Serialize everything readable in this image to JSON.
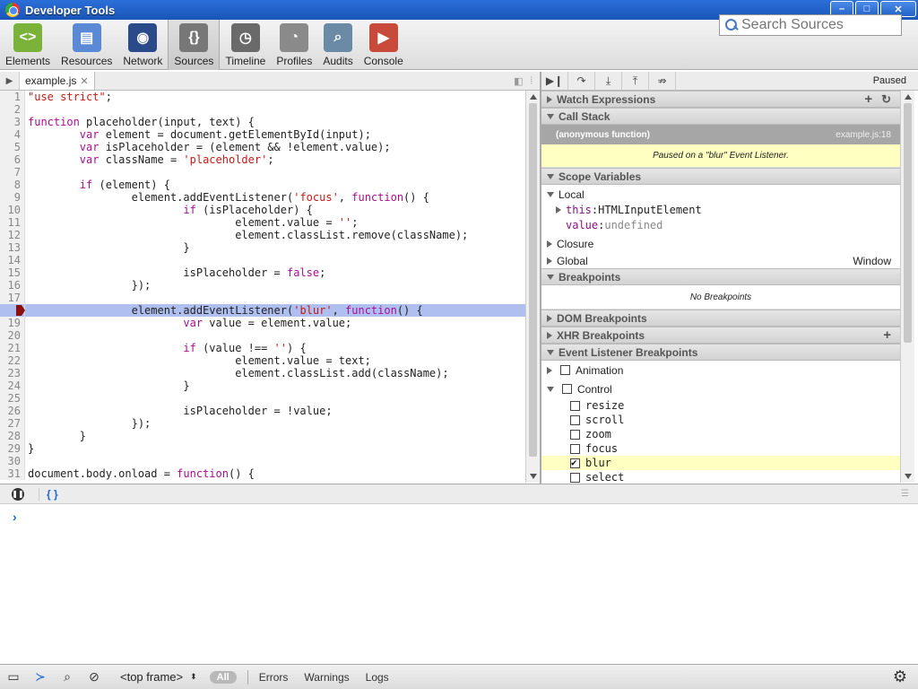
{
  "window": {
    "title": "Developer Tools",
    "controls": [
      "–",
      "□",
      "✕"
    ]
  },
  "toolbar": {
    "tools": [
      {
        "label": "Elements",
        "icon": "elements-icon",
        "color": "#7bb33a",
        "glyph": "<>"
      },
      {
        "label": "Resources",
        "icon": "resources-icon",
        "color": "#5a8ad6",
        "glyph": "▤"
      },
      {
        "label": "Network",
        "icon": "network-icon",
        "color": "#2a4a8a",
        "glyph": "◉"
      },
      {
        "label": "Sources",
        "icon": "sources-icon",
        "color": "#777777",
        "glyph": "{}"
      },
      {
        "label": "Timeline",
        "icon": "timeline-icon",
        "color": "#6a6a6a",
        "glyph": "◷"
      },
      {
        "label": "Profiles",
        "icon": "profiles-icon",
        "color": "#8a8a8a",
        "glyph": "◔"
      },
      {
        "label": "Audits",
        "icon": "audits-icon",
        "color": "#6a8aa6",
        "glyph": "⌕"
      },
      {
        "label": "Console",
        "icon": "console-icon",
        "color": "#c84a3a",
        "glyph": "▶"
      }
    ],
    "active": "Sources",
    "search_placeholder": "Search Sources"
  },
  "editor": {
    "tab": "example.js",
    "exec_line": 18,
    "lines": [
      {
        "n": "1",
        "html": "<span class=\"str\">\"use strict\"</span>;"
      },
      {
        "n": "2",
        "html": ""
      },
      {
        "n": "3",
        "html": "<span class=\"kw\">function</span> placeholder(input, text) {"
      },
      {
        "n": "4",
        "html": "        <span class=\"kw\">var</span> element = document.getElementById(input);"
      },
      {
        "n": "5",
        "html": "        <span class=\"kw\">var</span> isPlaceholder = (element &amp;&amp; !element.value);"
      },
      {
        "n": "6",
        "html": "        <span class=\"kw\">var</span> className = <span class=\"str\">'placeholder'</span>;"
      },
      {
        "n": "7",
        "html": ""
      },
      {
        "n": "8",
        "html": "        <span class=\"kw\">if</span> (element) {"
      },
      {
        "n": "9",
        "html": "                element.addEventListener(<span class=\"str\">'focus'</span>, <span class=\"kw\">function</span>() {"
      },
      {
        "n": "10",
        "html": "                        <span class=\"kw\">if</span> (isPlaceholder) {"
      },
      {
        "n": "11",
        "html": "                                element.value = <span class=\"str\">''</span>;"
      },
      {
        "n": "12",
        "html": "                                element.classList.remove(className);"
      },
      {
        "n": "13",
        "html": "                        }"
      },
      {
        "n": "14",
        "html": ""
      },
      {
        "n": "15",
        "html": "                        isPlaceholder = <span class=\"kw\">false</span>;"
      },
      {
        "n": "16",
        "html": "                });"
      },
      {
        "n": "17",
        "html": ""
      },
      {
        "n": "18",
        "html": "                element.addEventListener(<span class=\"str\">'blur'</span>, <span class=\"kw\">function</span>() {"
      },
      {
        "n": "19",
        "html": "                        <span class=\"kw\">var</span> value = element.value;"
      },
      {
        "n": "20",
        "html": ""
      },
      {
        "n": "21",
        "html": "                        <span class=\"kw\">if</span> (value !== <span class=\"str\">''</span>) {"
      },
      {
        "n": "22",
        "html": "                                element.value = text;"
      },
      {
        "n": "23",
        "html": "                                element.classList.add(className);"
      },
      {
        "n": "24",
        "html": "                        }"
      },
      {
        "n": "25",
        "html": ""
      },
      {
        "n": "26",
        "html": "                        isPlaceholder = !value;"
      },
      {
        "n": "27",
        "html": "                });"
      },
      {
        "n": "28",
        "html": "        }"
      },
      {
        "n": "29",
        "html": "}"
      },
      {
        "n": "30",
        "html": ""
      },
      {
        "n": "31",
        "html": "document.body.onload = <span class=\"kw\">function</span>() {"
      }
    ]
  },
  "debugger": {
    "paused_label": "Paused",
    "watch_title": "Watch Expressions",
    "callstack_title": "Call Stack",
    "frame_name": "(anonymous function)",
    "frame_location": "example.js:18",
    "pause_message": "Paused on a \"blur\" Event Listener.",
    "scope_title": "Scope Variables",
    "local_label": "Local",
    "this_name": "this",
    "this_value": "HTMLInputElement",
    "value_name": "value",
    "value_value": "undefined",
    "closure_label": "Closure",
    "global_label": "Global",
    "global_value": "Window",
    "breakpoints_title": "Breakpoints",
    "no_breakpoints": "No Breakpoints",
    "dom_bp_title": "DOM Breakpoints",
    "xhr_bp_title": "XHR Breakpoints",
    "event_bp_title": "Event Listener Breakpoints",
    "groups": {
      "animation": "Animation",
      "control": "Control"
    },
    "control_events": [
      {
        "name": "resize",
        "checked": false
      },
      {
        "name": "scroll",
        "checked": false
      },
      {
        "name": "zoom",
        "checked": false
      },
      {
        "name": "focus",
        "checked": false
      },
      {
        "name": "blur",
        "checked": true
      },
      {
        "name": "select",
        "checked": false
      }
    ]
  },
  "console": {
    "prompt": "›",
    "pretty_print": "{ }"
  },
  "statusbar": {
    "frame": "<top frame>",
    "all": "All",
    "filters": [
      "Errors",
      "Warnings",
      "Logs"
    ]
  }
}
